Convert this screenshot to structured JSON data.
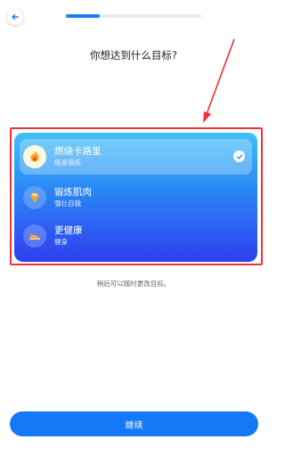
{
  "header": {
    "progress_fraction": 0.25
  },
  "question": "你想达到什么目标?",
  "options": [
    {
      "title": "燃烧卡路里",
      "subtitle": "瘦身锻炼",
      "icon": "flame-icon",
      "selected": true
    },
    {
      "title": "锻炼肌肉",
      "subtitle": "强壮自我",
      "icon": "diamond-icon",
      "selected": false
    },
    {
      "title": "更健康",
      "subtitle": "健身",
      "icon": "sneaker-icon",
      "selected": false
    }
  ],
  "hint": "稍后可以随时更改目标。",
  "continue_label": "继续",
  "colors": {
    "accent": "#1578f6",
    "annotation": "#f0303a",
    "card_top": "#3fc0f8",
    "card_bottom": "#2f3ef0"
  }
}
